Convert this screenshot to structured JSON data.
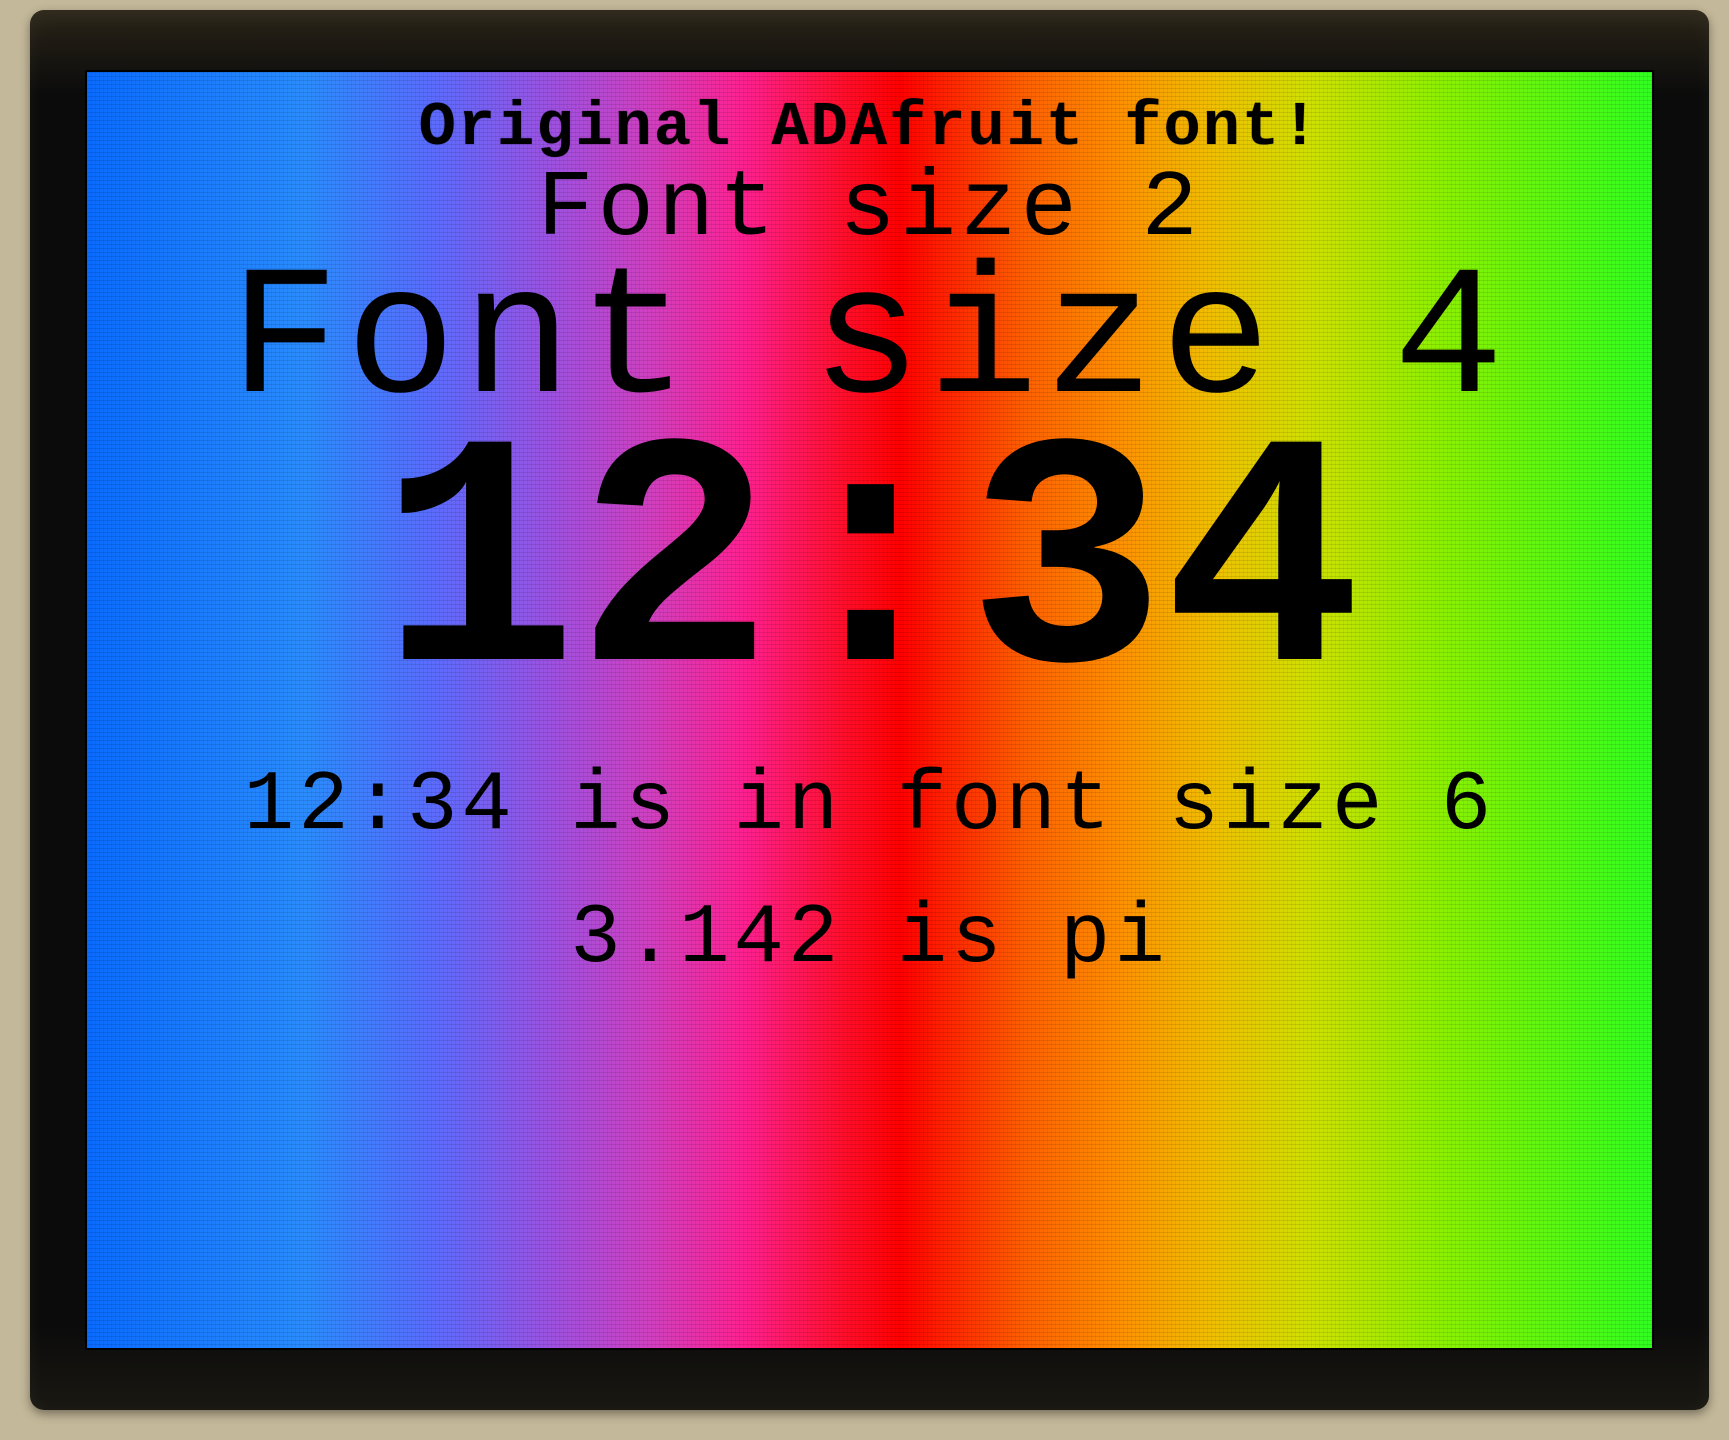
{
  "display": {
    "line1": "Original ADAfruit font!",
    "line2": "Font size 2",
    "line3": "Font size 4",
    "line4": "12:34",
    "line5": "12:34 is in font size 6",
    "line6": "3.142 is pi"
  }
}
